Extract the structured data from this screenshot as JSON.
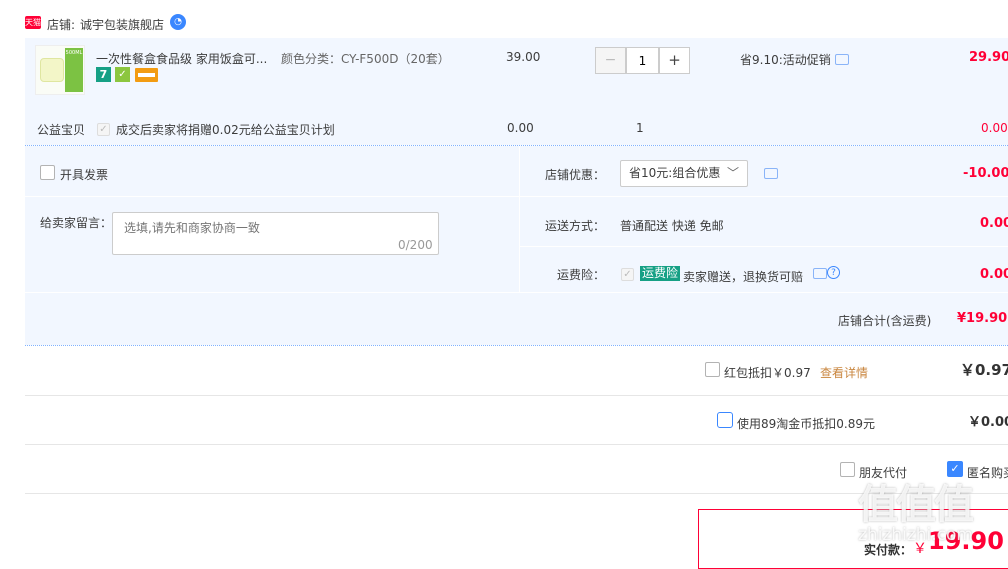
{
  "shop": {
    "badge": "天猫",
    "label": "店铺:",
    "name": "诚宇包装旗舰店"
  },
  "item": {
    "thumb_text": "500ML",
    "title": "一次性餐盒食品级 家用饭盒可...",
    "spec": "颜色分类：CY-F500D（20套）",
    "price": "39.00",
    "qty": "1",
    "promo": "省9.10:活动促销",
    "subtotal": "29.90"
  },
  "charity": {
    "label": "公益宝贝",
    "text": "成交后卖家将捐赠0.02元给公益宝贝计划",
    "price": "0.00",
    "qty": "1",
    "subtotal": "0.00"
  },
  "invoice": {
    "label": "开具发票"
  },
  "message": {
    "label": "给卖家留言：",
    "placeholder": "选填,请先和商家协商一致",
    "counter": "0/200"
  },
  "discount": {
    "label": "店铺优惠：",
    "selected": "省10元:组合优惠",
    "amount": "-10.00"
  },
  "shipping": {
    "label": "运送方式：",
    "value": "普通配送 快递 免邮",
    "amount": "0.00"
  },
  "insurance": {
    "label": "运费险：",
    "badge": "运费险",
    "text": "卖家赠送，退换货可赔",
    "amount": "0.00"
  },
  "shop_total": {
    "label": "店铺合计(含运费)",
    "value": "¥19.90"
  },
  "redpacket": {
    "label": "红包抵扣￥0.97",
    "link": "查看详情",
    "value": "￥0.97"
  },
  "coins": {
    "label": "使用89淘金币抵扣0.89元",
    "value": "￥0.00"
  },
  "friend": {
    "label": "朋友代付"
  },
  "anon": {
    "label": "匿名购买"
  },
  "pay": {
    "label": "实付款：",
    "currency": "￥",
    "value": "19.90"
  },
  "watermark": {
    "top": "值值值",
    "bottom": "zhizhizhi.com"
  },
  "colors": {
    "accent": "#ff0036",
    "blue": "#3a87ff",
    "rowbg": "#f2f7ff",
    "tmall": "#ff0036"
  }
}
